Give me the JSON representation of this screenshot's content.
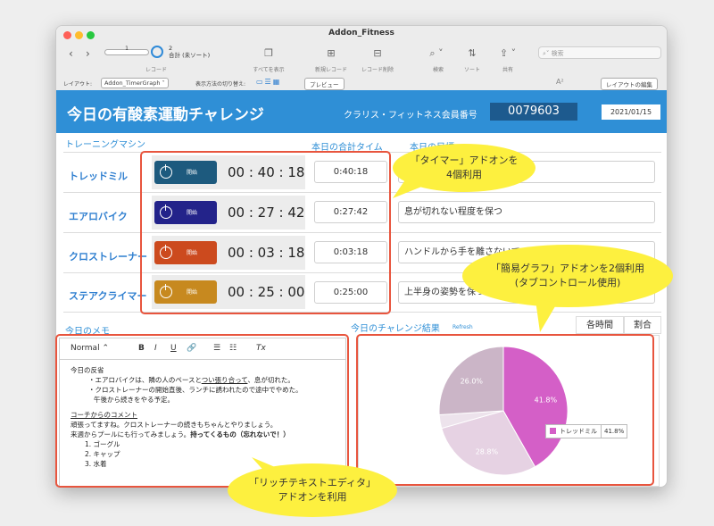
{
  "window": {
    "title": "Addon_Fitness"
  },
  "toolbar": {
    "record_number": "1",
    "record_count": "2",
    "record_count_note": "合計 (未ソート)",
    "record_label": "レコード",
    "show_all": "すべてを表示",
    "new_record": "新規レコード",
    "delete_record": "レコード削除",
    "find": "検索",
    "sort": "ソート",
    "share": "共有",
    "search_placeholder": "検索"
  },
  "layoutbar": {
    "layout_label": "レイアウト:",
    "layout_value": "Addon_TimerGraph",
    "view_switch_label": "表示方法の切り替え:",
    "preview": "プレビュー",
    "aa": "A²",
    "edit_layout": "レイアウトの編集"
  },
  "header": {
    "title": "今日の有酸素運動チャレンジ",
    "member_label": "クラリス・フィットネス会員番号",
    "member_number": "0079603",
    "date": "2021/01/15"
  },
  "sections": {
    "machines": "トレーニングマシン",
    "total_time": "本日の合計タイム",
    "goal": "本日の目標",
    "memo": "今日のメモ",
    "results": "今日のチャレンジ結果",
    "refresh": "Refresh"
  },
  "machines": [
    {
      "name": "トレッドミル",
      "start": "開始",
      "timer": "00 : 40 : 18",
      "total": "0:40:18",
      "goal": "",
      "color": "#1d5a7e"
    },
    {
      "name": "エアロバイク",
      "start": "開始",
      "timer": "00 : 27 : 42",
      "total": "0:27:42",
      "goal": "息が切れない程度を保つ",
      "color": "#23238a"
    },
    {
      "name": "クロストレーナー",
      "start": "開始",
      "timer": "00 : 03 : 18",
      "total": "0:03:18",
      "goal": "ハンドルから手を離さないでペダリングすること",
      "color": "#cc4a1e"
    },
    {
      "name": "ステアクライマー",
      "start": "開始",
      "timer": "00 : 25 : 00",
      "total": "0:25:00",
      "goal": "上半身の姿勢を保つこと",
      "color": "#c7891f"
    }
  ],
  "editor": {
    "toolbar": {
      "format": "Normal",
      "bold": "B",
      "italic": "I",
      "underline": "U",
      "link": "🔗",
      "ol": "☰",
      "ul": "☷",
      "clear": "Tx"
    },
    "heading1": "今日の反省",
    "line1a": "・エアロバイクは、隣の人のペースと",
    "line1b": "つい張り合って",
    "line1c": "、息が切れた。",
    "line2": "・クロストレーナーの開始直後、ランチに誘われたので途中でやめた。",
    "line3": "午後から続きをやる予定。",
    "heading2": "コーチからのコメント",
    "line4": "頑張ってますね。クロストレーナーの続きもちゃんとやりましょう。",
    "line5a": "来週からプールにも行ってみましょう。",
    "line5b": "持ってくるもの（忘れないで！）",
    "list": [
      "1. ゴーグル",
      "2. キャップ",
      "3. 水着"
    ]
  },
  "tabs": [
    {
      "label": "各時間"
    },
    {
      "label": "割合"
    }
  ],
  "chart_data": {
    "type": "pie",
    "categories": [
      "トレッドミル",
      "エアロバイク",
      "クロストレーナー",
      "ステアクライマー"
    ],
    "values": [
      41.8,
      28.8,
      3.4,
      26.0
    ],
    "labels": [
      "41.8%",
      "28.8%",
      "",
      "26.0%"
    ],
    "colors": [
      "#d45fc7",
      "#e6d2e3",
      "#ede3ec",
      "#cbb5c7"
    ],
    "tooltip": {
      "name": "トレッドミル",
      "value": "41.8%"
    }
  },
  "callouts": {
    "timer": [
      "「タイマー」アドオンを",
      "4個利用"
    ],
    "graph": [
      "「簡易グラフ」アドオンを2個利用",
      "(タブコントロール使用)"
    ],
    "editor": [
      "「リッチテキストエディタ」",
      "アドオンを利用"
    ]
  }
}
